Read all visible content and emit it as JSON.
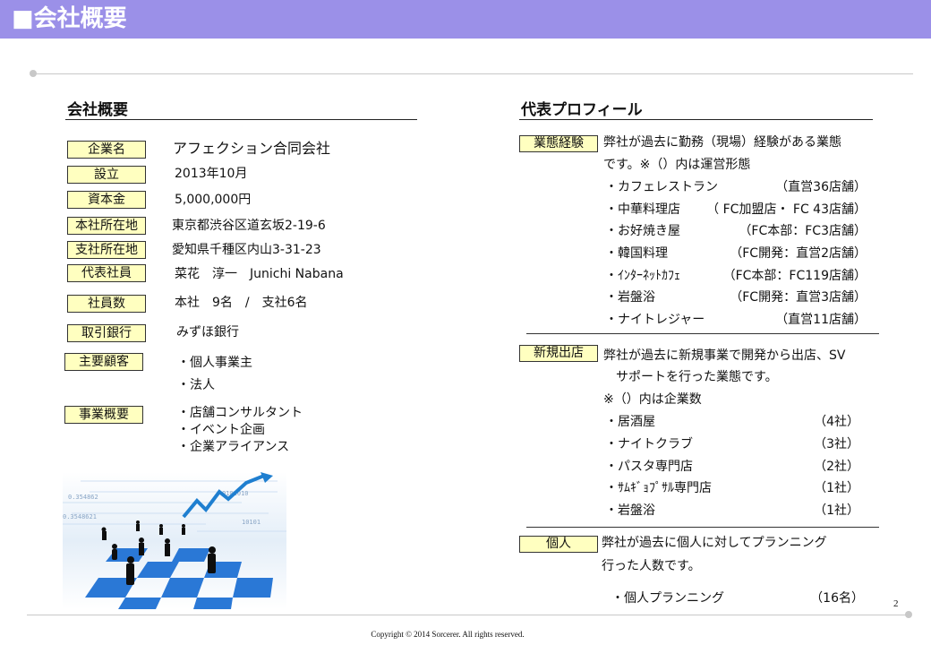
{
  "header": {
    "title": "■会社概要"
  },
  "company": {
    "heading": "会社概要",
    "rows": [
      {
        "label": "企業名",
        "value": "アフェクション合同会社"
      },
      {
        "label": "設立",
        "value": "2013年10月"
      },
      {
        "label": "資本金",
        "value": "5,000,000円"
      },
      {
        "label": "本社所在地",
        "value": "東京都渋谷区道玄坂2-19-6"
      },
      {
        "label": "支社所在地",
        "value": "愛知県千種区内山3-31-23"
      },
      {
        "label": "代表社員",
        "value": "菜花　淳一　Junichi Nabana"
      },
      {
        "label": "社員数",
        "value": "本社　9名　/　支社6名"
      },
      {
        "label": "取引銀行",
        "value": "みずほ銀行"
      },
      {
        "label": "主要顧客",
        "values": [
          "・個人事業主",
          "・法人"
        ]
      },
      {
        "label": "事業概要",
        "values": [
          "・店舗コンサルタント",
          "・イベント企画",
          "・企業アライアンス"
        ]
      }
    ]
  },
  "profile": {
    "heading": "代表プロフィール",
    "blocks": [
      {
        "label": "業態経験",
        "desc": [
          "弊社が過去に勤務（現場）経験がある業態",
          "です。※（）内は運営形態"
        ],
        "items": [
          {
            "name": "・カフェレストラン",
            "note": "（直営36店舗）"
          },
          {
            "name": "・中華料理店",
            "note": "（ FC加盟店・ FC 43店舗）"
          },
          {
            "name": "・お好焼き屋",
            "note": "（FC本部：FC3店舗）"
          },
          {
            "name": "・韓国料理",
            "note": "（FC開発：直営2店舗）"
          },
          {
            "name": "・ｲﾝﾀｰﾈｯﾄｶﾌｪ",
            "note": "（FC本部：FC119店舗）"
          },
          {
            "name": "・岩盤浴",
            "note": "（FC開発：直営3店舗）"
          },
          {
            "name": "・ナイトレジャー",
            "note": "（直営11店舗）"
          }
        ]
      },
      {
        "label": "新規出店",
        "desc": [
          "弊社が過去に新規事業で開発から出店、SV",
          "　サポートを行った業態です。",
          "※（）内は企業数"
        ],
        "items": [
          {
            "name": "・居酒屋",
            "note": "（4社）"
          },
          {
            "name": "・ナイトクラブ",
            "note": "（3社）"
          },
          {
            "name": "・パスタ専門店",
            "note": "（2社）"
          },
          {
            "name": "・ｻﾑｷﾞｮﾌﾟｻﾙ専門店",
            "note": "（1社）"
          },
          {
            "name": "・岩盤浴",
            "note": "（1社）"
          }
        ]
      },
      {
        "label": "個人",
        "desc": [
          "弊社が過去に個人に対してプランニング",
          "行った人数です。"
        ],
        "items": [
          {
            "name": "・個人プランニング",
            "note": "（16名）"
          }
        ]
      }
    ]
  },
  "illustration": {
    "digits": [
      "0101010",
      "0.354862",
      "0.3548621",
      "10101"
    ]
  },
  "footer": {
    "page": "2",
    "copyright": "Copyright © 2014 Sorcerer. All rights reserved."
  }
}
